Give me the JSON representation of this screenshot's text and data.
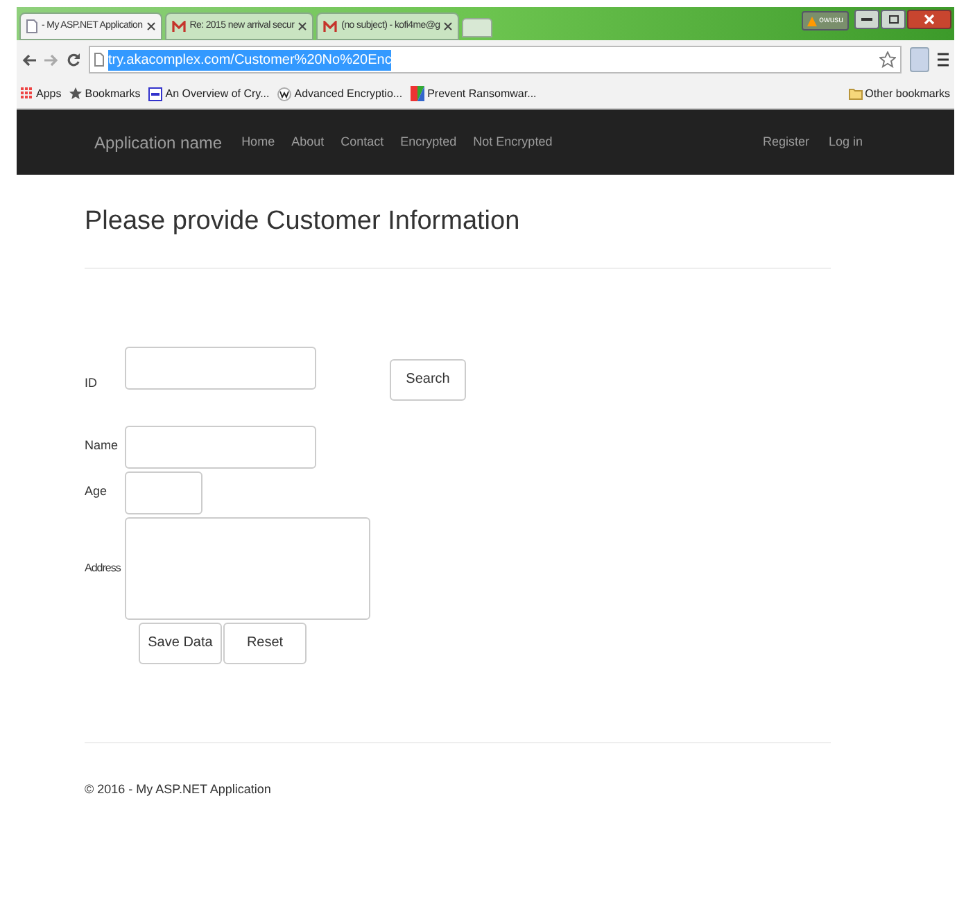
{
  "browser": {
    "tabs": [
      {
        "title": "- My ASP.NET Application",
        "selected": true
      },
      {
        "title": "Re: 2015 new arrival secur",
        "selected": false
      },
      {
        "title": "(no subject) - kofi4me@g",
        "selected": false
      }
    ],
    "user_badge": "owusu",
    "url": "try.akacomplex.com/Customer%20No%20Enc",
    "bookmarks": [
      "Apps",
      "Bookmarks",
      "An Overview of Cry...",
      "Advanced Encryptio...",
      "Prevent Ransomwar..."
    ],
    "other_bookmarks": "Other bookmarks"
  },
  "navbar": {
    "brand": "Application name",
    "links": [
      "Home",
      "About",
      "Contact",
      "Encrypted",
      "Not Encrypted"
    ],
    "right_links": [
      "Register",
      "Log in"
    ]
  },
  "heading": "Please provide Customer Information",
  "form": {
    "id_label": "ID",
    "search_button": "Search",
    "name_label": "Name",
    "age_label": "Age",
    "address_label": "Address",
    "buttons": [
      "Save Data",
      "Reset"
    ]
  },
  "footer": "© 2016 - My ASP.NET Application"
}
